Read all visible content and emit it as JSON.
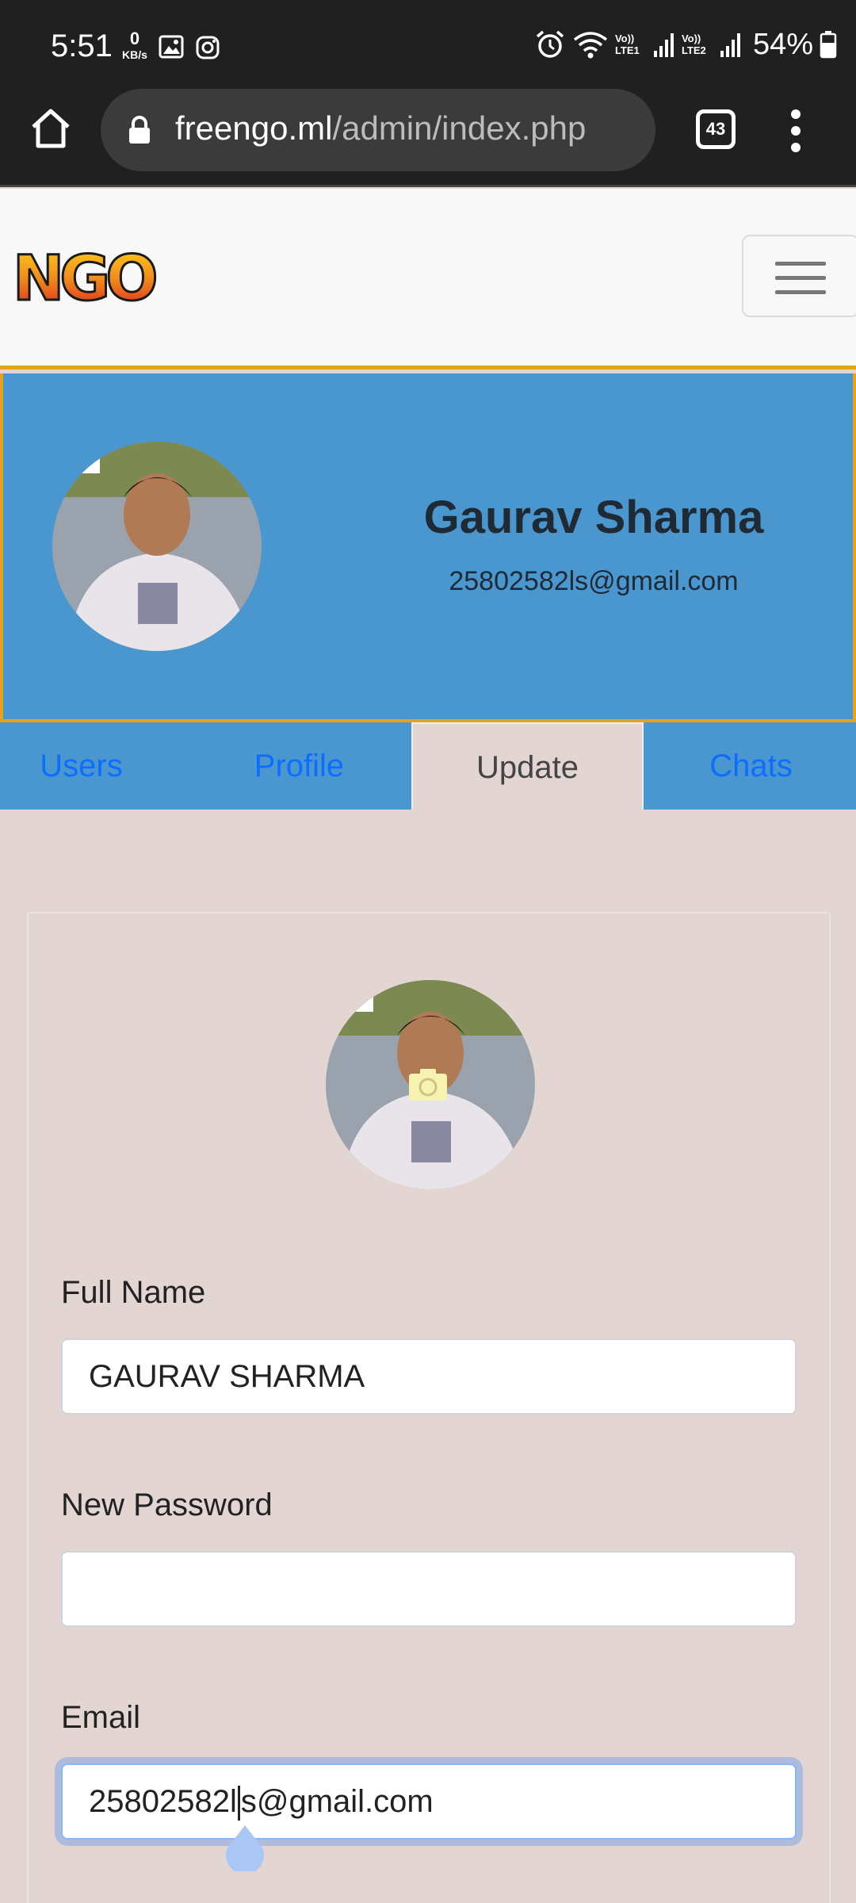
{
  "status_bar": {
    "time": "5:51",
    "net_speed_value": "0",
    "net_speed_unit": "KB/s",
    "lte1_label": "Vo)) LTE1",
    "lte2_label": "Vo)) LTE2",
    "battery": "54%"
  },
  "browser": {
    "url_host": "freengo.ml",
    "url_path": "/admin/index.php",
    "tab_count": "43"
  },
  "navbar": {
    "logo_text": "NGO"
  },
  "profile": {
    "name": "Gaurav Sharma",
    "email": "25802582ls@gmail.com"
  },
  "tabs": [
    {
      "label": "Users"
    },
    {
      "label": "Profile"
    },
    {
      "label": "Update"
    },
    {
      "label": "Chats"
    }
  ],
  "form": {
    "full_name_label": "Full Name",
    "full_name_value": "GAURAV SHARMA",
    "password_label": "New Password",
    "password_value": "",
    "email_label": "Email",
    "email_value_before_caret": "25802582l",
    "email_value_after_caret": "s@gmail.com"
  },
  "colors": {
    "banner": "#4a97d0",
    "accent_border": "#e6a21a",
    "page_bg": "#e3d5d2",
    "link": "#0d6efd"
  }
}
